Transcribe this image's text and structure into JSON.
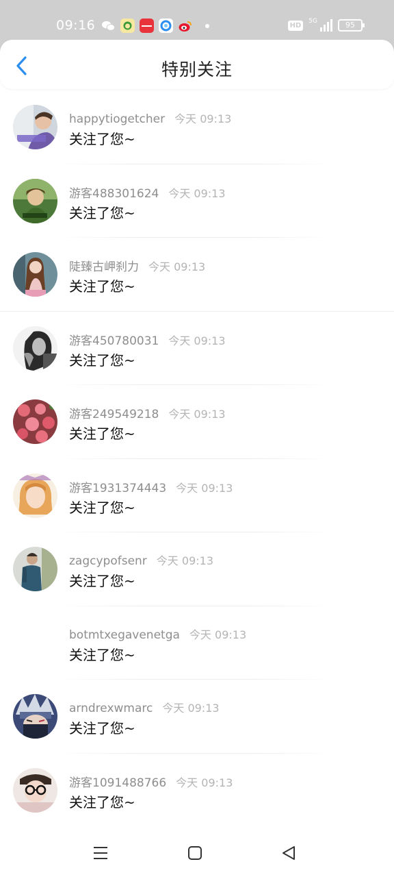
{
  "status_bar": {
    "time": "09:16",
    "notification_icons": [
      "wechat-icon",
      "meitu-icon",
      "xiaohongshu-icon",
      "qq-browser-icon",
      "weibo-icon"
    ],
    "network": "5G",
    "hd": "HD",
    "battery": "95"
  },
  "header": {
    "title": "特别关注",
    "back_icon": "chevron-left-icon"
  },
  "colors": {
    "accent": "#2b8ef0",
    "status_bar_bg": "#cfcfcf",
    "name_text": "#8e8e8e",
    "time_text": "#b4b4b4"
  },
  "items": [
    {
      "name": "happytiogetcher",
      "time": "今天 09:13",
      "message": "关注了您~",
      "avatar": "avatar-photo"
    },
    {
      "name": "游客488301624",
      "time": "今天 09:13",
      "message": "关注了您~",
      "avatar": "avatar-photo"
    },
    {
      "name": "陡臻古岬刹力",
      "time": "今天 09:13",
      "message": "关注了您~",
      "avatar": "avatar-photo"
    },
    {
      "name": "游客450780031",
      "time": "今天 09:13",
      "message": "关注了您~",
      "avatar": "avatar-photo"
    },
    {
      "name": "游客249549218",
      "time": "今天 09:13",
      "message": "关注了您~",
      "avatar": "avatar-photo"
    },
    {
      "name": "游客1931374443",
      "time": "今天 09:13",
      "message": "关注了您~",
      "avatar": "avatar-photo"
    },
    {
      "name": "zagcypofsenr",
      "time": "今天 09:13",
      "message": "关注了您~",
      "avatar": "avatar-photo"
    },
    {
      "name": "botmtxegavenetga",
      "time": "今天 09:13",
      "message": "关注了您~",
      "avatar": "none"
    },
    {
      "name": "arndrexwmarc",
      "time": "今天 09:13",
      "message": "关注了您~",
      "avatar": "avatar-photo"
    },
    {
      "name": "游客1091488766",
      "time": "今天 09:13",
      "message": "关注了您~",
      "avatar": "avatar-photo"
    }
  ],
  "nav_bar": {
    "icons": [
      "menu-icon",
      "home-square-icon",
      "back-triangle-icon"
    ]
  }
}
